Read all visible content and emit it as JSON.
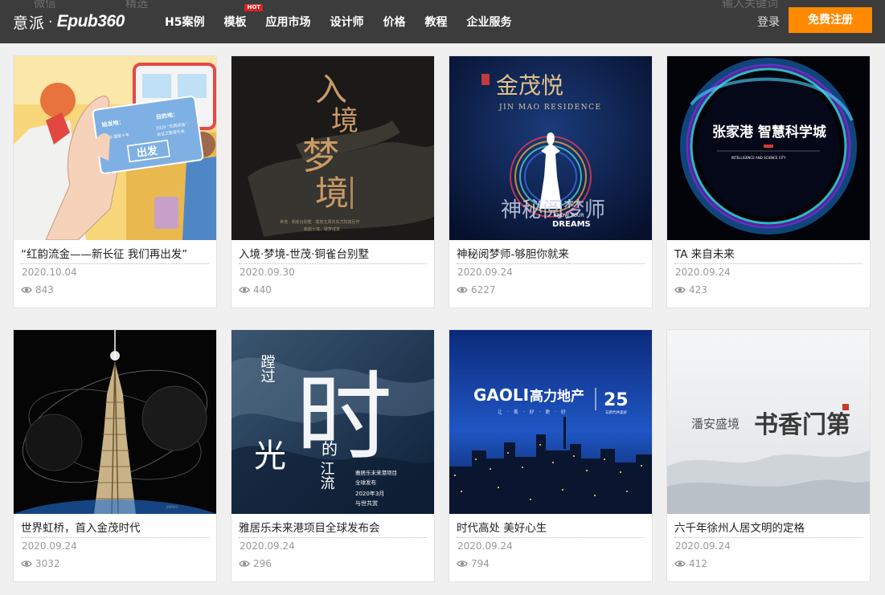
{
  "header": {
    "ghost_left_1": "微信",
    "ghost_left_2": "精选",
    "ghost_right": "输入关键词",
    "logo_cn": "意派",
    "logo_dot": "·",
    "logo_en": "Epub360",
    "nav": [
      {
        "label": "H5案例"
      },
      {
        "label": "模板",
        "badge": "HOT"
      },
      {
        "label": "应用市场"
      },
      {
        "label": "设计师"
      },
      {
        "label": "价格"
      },
      {
        "label": "教程"
      },
      {
        "label": "企业服务"
      }
    ],
    "login_label": "登录",
    "register_label": "免费注册"
  },
  "cards": [
    {
      "title": "“红韵流金——新长征 我们再出发”",
      "date": "2020.10.04",
      "views": "843",
      "art": {
        "ticket_label_1": "始发地：",
        "ticket_label_2": "目的地：",
        "ticket_line_1": "2010 国家十年",
        "ticket_line_2": "2020 “红韵流金”",
        "ticket_line_3": "长征之歌音乐会",
        "ticket_stamp": "出发"
      }
    },
    {
      "title": "入境·梦境-世茂·铜雀台别墅",
      "date": "2020.09.30",
      "views": "440",
      "art": {
        "title_chars": [
          "入",
          "境",
          "梦",
          "境"
        ],
        "caption": "世茂 · 铜雀台别墅 · 载誉五周年东方院落巨作",
        "caption2": "新韵十境，破梦成真"
      }
    },
    {
      "title": "神秘阅梦师-够胆你就来",
      "date": "2020.09.24",
      "views": "6227",
      "art": {
        "brand": "金茂悦",
        "brand_en": "JIN MAO RESIDENCE",
        "slogan": "神秘阅梦师",
        "slogan_en_1": "KNOW YOUR",
        "slogan_en_2": "DREAMS"
      }
    },
    {
      "title": "TA 来自未来",
      "date": "2020.09.24",
      "views": "423",
      "art": {
        "headline": "张家港 智慧科学城",
        "subline": "INTELLIGENCE AND SCIENCE CITY"
      }
    },
    {
      "title": "世界虹桥，首入金茂时代",
      "date": "2020.09.24",
      "views": "3032",
      "art": {}
    },
    {
      "title": "雅居乐未来港项目全球发布会",
      "date": "2020.09.24",
      "views": "296",
      "art": {
        "vertical_1": "蹚过",
        "big": "时",
        "vertical_2": "光",
        "vertical_3": "的",
        "vertical_4": "江流",
        "info_1": "雅居乐未来港项目",
        "info_2": "全球发布",
        "info_3": "2020年3月",
        "info_4": "与世共赏"
      }
    },
    {
      "title": "时代高处 美好心生",
      "date": "2020.09.24",
      "views": "794",
      "art": {
        "brand_en": "GAOLI",
        "brand_cn": "高力地产",
        "num": "25",
        "tagline": "让 · 美 · 好 · 更 · 好",
        "num_sub": "与新代共美好"
      }
    },
    {
      "title": "六千年徐州人居文明的定格",
      "date": "2020.09.24",
      "views": "412",
      "art": {
        "left_text": "潘安盛境",
        "callig": "书香门第"
      }
    }
  ],
  "colors": {
    "topbar": "#3c3c3c",
    "register": "#ff8a00",
    "hot_badge": "#e02020",
    "page_bg": "#f0f0f0"
  },
  "icons": {
    "views": "eye-icon"
  }
}
